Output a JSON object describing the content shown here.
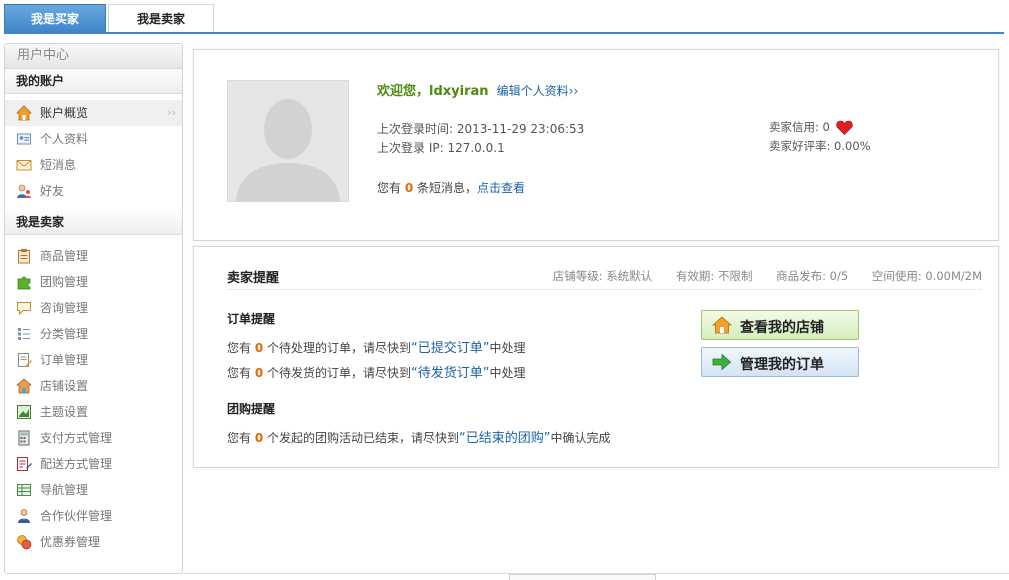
{
  "tabs": [
    {
      "label": "我是买家",
      "active": true
    },
    {
      "label": "我是卖家",
      "active": false
    }
  ],
  "sidebar": {
    "title": "用户中心",
    "account_section": "我的账户",
    "account_items": [
      {
        "label": "账户概览",
        "icon": "home-icon"
      },
      {
        "label": "个人资料",
        "icon": "profile-card-icon"
      },
      {
        "label": "短消息",
        "icon": "envelope-icon"
      },
      {
        "label": "好友",
        "icon": "friends-icon"
      }
    ],
    "seller_section": "我是卖家",
    "seller_items": [
      {
        "label": "商品管理",
        "icon": "clipboard-icon"
      },
      {
        "label": "团购管理",
        "icon": "puzzle-icon"
      },
      {
        "label": "咨询管理",
        "icon": "chat-bubble-icon"
      },
      {
        "label": "分类管理",
        "icon": "list-icon"
      },
      {
        "label": "订单管理",
        "icon": "edit-document-icon"
      },
      {
        "label": "店铺设置",
        "icon": "store-icon"
      },
      {
        "label": "主题设置",
        "icon": "theme-icon"
      },
      {
        "label": "支付方式管理",
        "icon": "calculator-icon"
      },
      {
        "label": "配送方式管理",
        "icon": "delivery-icon"
      },
      {
        "label": "导航管理",
        "icon": "table-icon"
      },
      {
        "label": "合作伙伴管理",
        "icon": "partner-icon"
      },
      {
        "label": "优惠券管理",
        "icon": "coupon-icon"
      }
    ],
    "arrow": "››"
  },
  "profile": {
    "welcome": "欢迎您，",
    "username": "ldxyiran",
    "edit_link": "编辑个人资料››",
    "last_login_time": "上次登录时间: 2013-11-29 23:06:53",
    "last_login_ip": "上次登录 IP: 127.0.0.1",
    "msg_prefix": "您有",
    "msg_count": "0",
    "msg_mid": "条短消息，",
    "msg_link": "点击查看",
    "seller_credit_label": "卖家信用: 0",
    "seller_rate": "卖家好评率: 0.00%"
  },
  "seller_panel": {
    "title": "卖家提醒",
    "store_level": "店铺等级: 系统默认",
    "validity": "有效期: 不限制",
    "goods_published": "商品发布: 0/5",
    "space_used": "空间使用: 0.00M/2M",
    "order_section": "订单提醒",
    "order_line1": {
      "prefix": "您有",
      "count": "0",
      "mid": "个待处理的订单，请尽快到",
      "link": "“已提交订单”",
      "suffix": "中处理"
    },
    "order_line2": {
      "prefix": "您有",
      "count": "0",
      "mid": "个待发货的订单，请尽快到",
      "link": "“待发货订单”",
      "suffix": "中处理"
    },
    "group_section": "团购提醒",
    "group_line": {
      "prefix": "您有",
      "count": "0",
      "mid": "个发起的团购活动已结束，请尽快到",
      "link": "“已结束的团购”",
      "suffix": "中确认完成"
    },
    "btn_store": "查看我的店铺",
    "btn_orders": "管理我的订单"
  }
}
